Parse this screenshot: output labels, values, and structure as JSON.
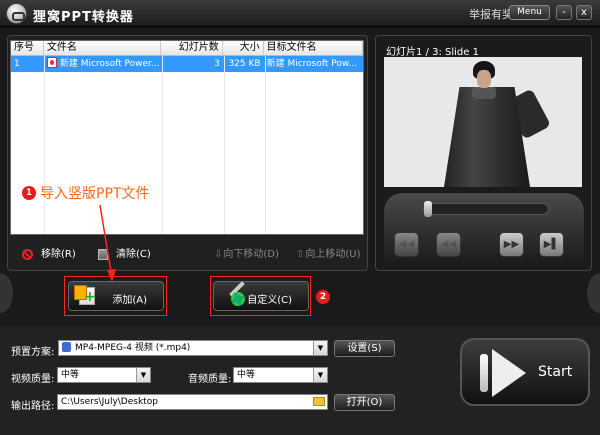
{
  "titlebar": {
    "title": "狸窝PPT转换器",
    "report": "举报有奖",
    "menu": "Menu",
    "min": "-",
    "close": "x"
  },
  "table": {
    "headers": [
      "序号",
      "文件名",
      "幻灯片数",
      "大小",
      "目标文件名"
    ],
    "rows": [
      {
        "index": "1",
        "filename": "新建 Microsoft Power...",
        "slides": "3",
        "size": "325 KB",
        "target": "新建 Microsoft Pow..."
      }
    ]
  },
  "toolbar": {
    "remove": "移除(R)",
    "clear": "清除(C)",
    "move_down": "向下移动(D)",
    "move_up": "向上移动(U)"
  },
  "preview": {
    "slide_label": "幻灯片1 / 3: Slide 1"
  },
  "player": {
    "rewind": "◀◀",
    "back": "◀◀",
    "forward": "▶▶",
    "next": "▶▌"
  },
  "buttons": {
    "add": "添加(A)",
    "custom": "自定义(C)"
  },
  "annotations": {
    "step1_num": "1",
    "step1_text": "导入竖版PPT文件",
    "step2_num": "2"
  },
  "settings": {
    "preset_label": "预置方案:",
    "preset_value": "MP4-MPEG-4 视频 (*.mp4)",
    "settings_btn": "设置(S)",
    "video_quality_label": "视频质量:",
    "video_quality": "中等",
    "audio_quality_label": "音频质量:",
    "audio_quality": "中等",
    "output_label": "输出路径:",
    "output_path": "C:\\Users\\July\\Desktop",
    "open_btn": "打开(O)",
    "dropdown": "▼"
  },
  "start": {
    "label": "Start"
  },
  "colors": {
    "selection": "#3399ff",
    "highlight": "#ff2020",
    "annotation": "#ff6a1a"
  }
}
